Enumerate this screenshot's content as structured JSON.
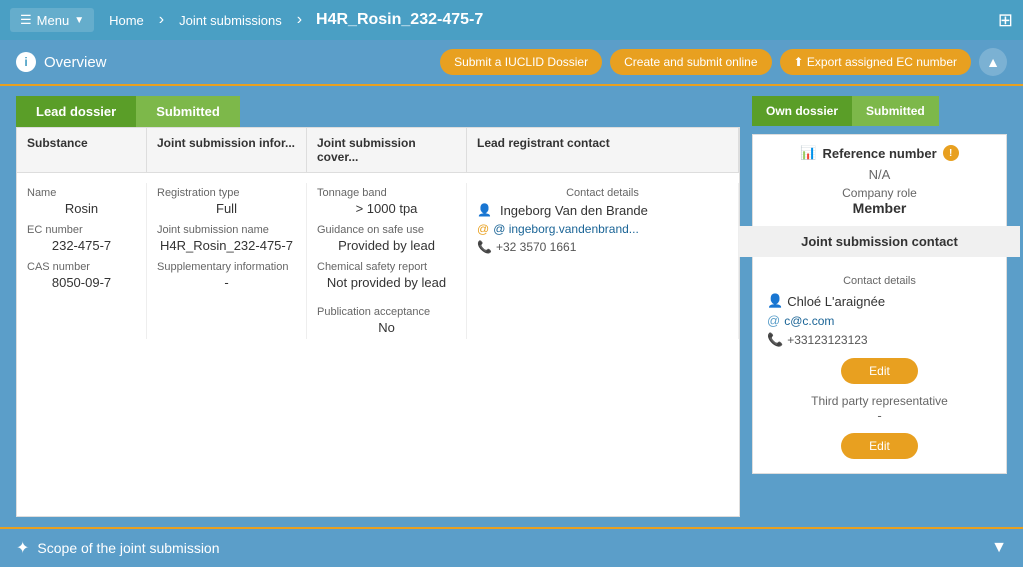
{
  "nav": {
    "menu_label": "Menu",
    "home_link": "Home",
    "joint_submissions_link": "Joint submissions",
    "page_title": "H4R_Rosin_232-475-7"
  },
  "info_bar": {
    "overview_label": "Overview",
    "btn_submit_iuclid": "Submit a IUCLID Dossier",
    "btn_create_submit": "Create and submit online",
    "btn_export_ec": "Export assigned EC number"
  },
  "left_tabs": {
    "tab1_label": "Lead dossier",
    "tab2_label": "Submitted"
  },
  "right_tabs": {
    "tab1_label": "Own dossier",
    "tab2_label": "Submitted"
  },
  "table_headers": {
    "substance": "Substance",
    "joint_submission_info": "Joint submission infor...",
    "joint_submission_cover": "Joint submission cover...",
    "lead_registrant_contact": "Lead registrant contact"
  },
  "substance_col": {
    "name_label": "Name",
    "name_value": "Rosin",
    "ec_label": "EC number",
    "ec_value": "232-475-7",
    "cas_label": "CAS number",
    "cas_value": "8050-09-7"
  },
  "joint_info_col": {
    "reg_type_label": "Registration type",
    "reg_type_value": "Full",
    "joint_name_label": "Joint submission name",
    "joint_name_value": "H4R_Rosin_232-475-7",
    "supp_info_label": "Supplementary information",
    "supp_info_value": "-"
  },
  "joint_cover_col": {
    "tonnage_label": "Tonnage band",
    "tonnage_value": "> 1000 tpa",
    "guidance_label": "Guidance on safe use",
    "guidance_value": "Provided by lead",
    "csr_label": "Chemical safety report",
    "csr_value": "Not provided by lead",
    "pub_label": "Publication acceptance",
    "pub_value": "No"
  },
  "lead_contact_col": {
    "contact_details_label": "Contact details",
    "person_name": "Ingeborg Van den Brande",
    "email": "@ ingeborg.vandenbrand...",
    "phone": "+32 3570 1661"
  },
  "reference_number": {
    "title": "Reference number",
    "value": "N/A",
    "company_role_label": "Company role",
    "company_role_value": "Member"
  },
  "joint_submission_contact": {
    "title": "Joint submission contact",
    "contact_details_label": "Contact details",
    "person_name": "Chloé L'araignée",
    "email": "c@c.com",
    "phone": "+33123123123",
    "edit_btn": "Edit",
    "third_party_label": "Third party representative",
    "third_party_value": "-",
    "edit_btn2": "Edit"
  },
  "bottom_bar": {
    "scope_label": "Scope of the joint submission"
  }
}
